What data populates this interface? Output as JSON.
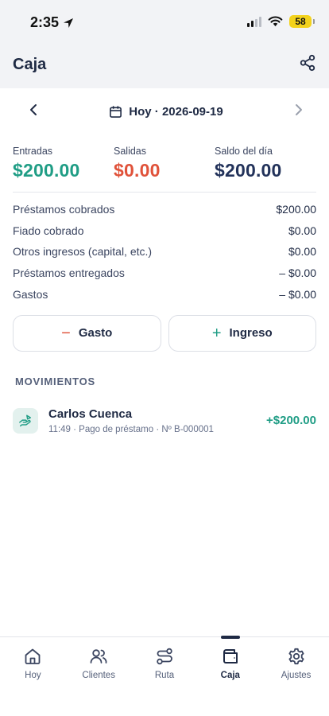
{
  "status_bar": {
    "time": "2:35",
    "battery": "58"
  },
  "header": {
    "title": "Caja",
    "share_icon": "share-icon"
  },
  "date_nav": {
    "label": "Hoy · 2026-09-19"
  },
  "summary": {
    "entradas_label": "Entradas",
    "entradas_value": "$200.00",
    "salidas_label": "Salidas",
    "salidas_value": "$0.00",
    "saldo_label": "Saldo del día",
    "saldo_value": "$200.00"
  },
  "breakdown": [
    {
      "label": "Préstamos cobrados",
      "value": "$200.00"
    },
    {
      "label": "Fiado cobrado",
      "value": "$0.00"
    },
    {
      "label": "Otros ingresos (capital, etc.)",
      "value": "$0.00"
    },
    {
      "label": "Préstamos entregados",
      "value": "– $0.00"
    },
    {
      "label": "Gastos",
      "value": "– $0.00"
    }
  ],
  "actions": {
    "gasto_symbol": "−",
    "gasto_label": "Gasto",
    "ingreso_symbol": "+",
    "ingreso_label": "Ingreso"
  },
  "movimientos": {
    "title": "MOVIMIENTOS",
    "items": [
      {
        "name": "Carlos Cuenca",
        "detail": "11:49 · Pago de préstamo · Nº B-000001",
        "amount": "+$200.00"
      }
    ]
  },
  "tabs": [
    {
      "label": "Hoy",
      "icon": "home-icon"
    },
    {
      "label": "Clientes",
      "icon": "users-icon"
    },
    {
      "label": "Ruta",
      "icon": "route-icon"
    },
    {
      "label": "Caja",
      "icon": "wallet-icon",
      "active": true
    },
    {
      "label": "Ajustes",
      "icon": "gear-icon"
    }
  ],
  "colors": {
    "green": "#1f9d85",
    "red": "#e0523a",
    "navy": "#22325a",
    "battery": "#f3d21c"
  }
}
